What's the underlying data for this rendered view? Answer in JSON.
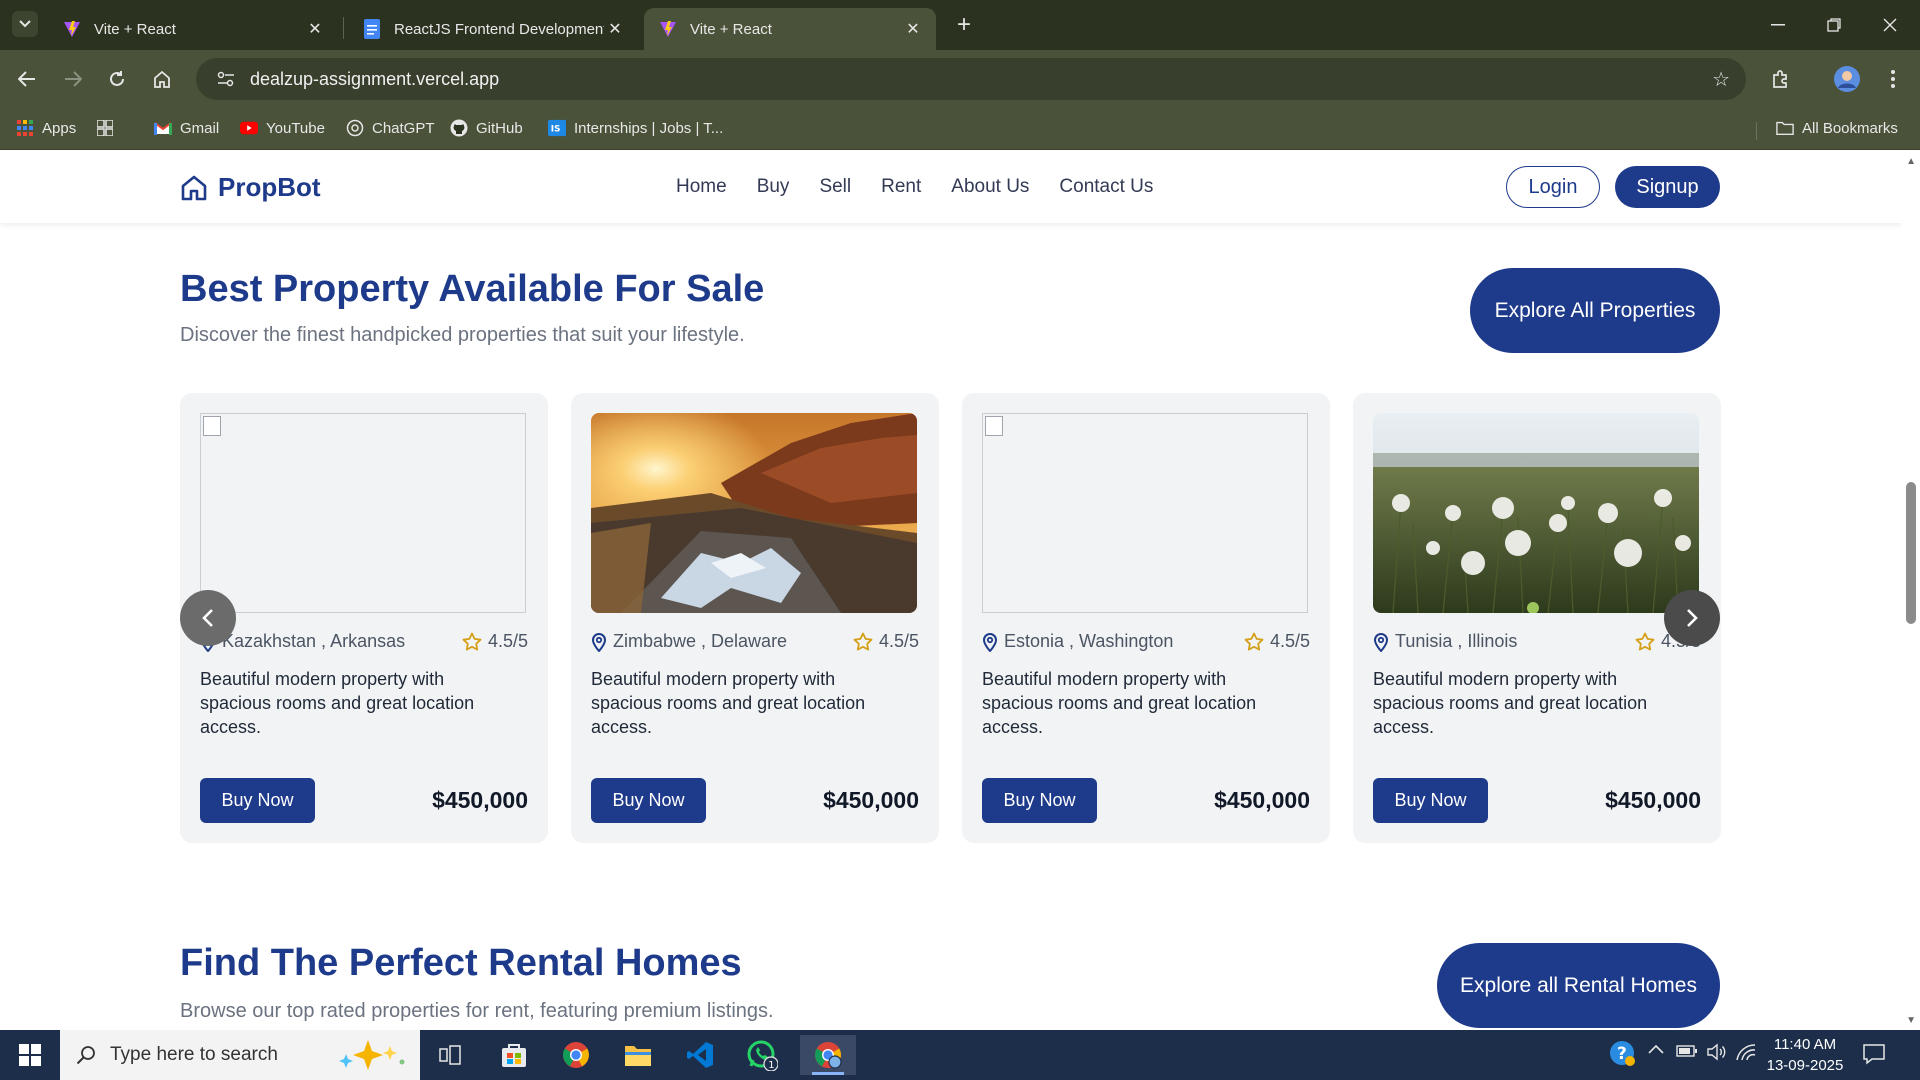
{
  "browser": {
    "tabs": [
      {
        "title": "Vite + React",
        "active": false
      },
      {
        "title": "ReactJS Frontend Development",
        "active": false
      },
      {
        "title": "Vite + React",
        "active": true
      }
    ],
    "url": "dealzup-assignment.vercel.app",
    "bookmarks": [
      "Apps",
      "Gmail",
      "YouTube",
      "ChatGPT",
      "GitHub",
      "Internships | Jobs | T...",
      "All Bookmarks"
    ]
  },
  "site": {
    "brand": "PropBot",
    "nav": [
      "Home",
      "Buy",
      "Sell",
      "Rent",
      "About Us",
      "Contact Us"
    ],
    "login": "Login",
    "signup": "Signup"
  },
  "sale": {
    "title": "Best Property Available For Sale",
    "subtitle": "Discover the finest handpicked properties that suit your lifestyle.",
    "explore": "Explore All Properties",
    "cards": [
      {
        "location": "Kazakhstan , Arkansas",
        "rating": "4.5/5",
        "description": "Beautiful modern property with spacious rooms and great location access.",
        "buy": "Buy Now",
        "price": "$450,000",
        "image": "broken"
      },
      {
        "location": "Zimbabwe , Delaware",
        "rating": "4.5/5",
        "description": "Beautiful modern property with spacious rooms and great location access.",
        "buy": "Buy Now",
        "price": "$450,000",
        "image": "sunset-road"
      },
      {
        "location": "Estonia , Washington",
        "rating": "4.5/5",
        "description": "Beautiful modern property with spacious rooms and great location access.",
        "buy": "Buy Now",
        "price": "$450,000",
        "image": "broken"
      },
      {
        "location": "Tunisia , Illinois",
        "rating": "4.5/5",
        "description": "Beautiful modern property with spacious rooms and great location access.",
        "buy": "Buy Now",
        "price": "$450,000",
        "image": "dandelion-field"
      }
    ]
  },
  "rental": {
    "title": "Find The Perfect Rental Homes",
    "subtitle": "Browse our top rated properties for rent, featuring premium listings.",
    "explore": "Explore all Rental Homes"
  },
  "taskbar": {
    "search_placeholder": "Type here to search",
    "time": "11:40 AM",
    "date": "13-09-2025",
    "whatsapp_badge": "1"
  },
  "colors": {
    "brand": "#1e3a8a",
    "chrome_frame": "#2b3220",
    "chrome_toolbar": "#4a5239",
    "card_bg": "#f2f3f5",
    "star": "#d4a017"
  }
}
